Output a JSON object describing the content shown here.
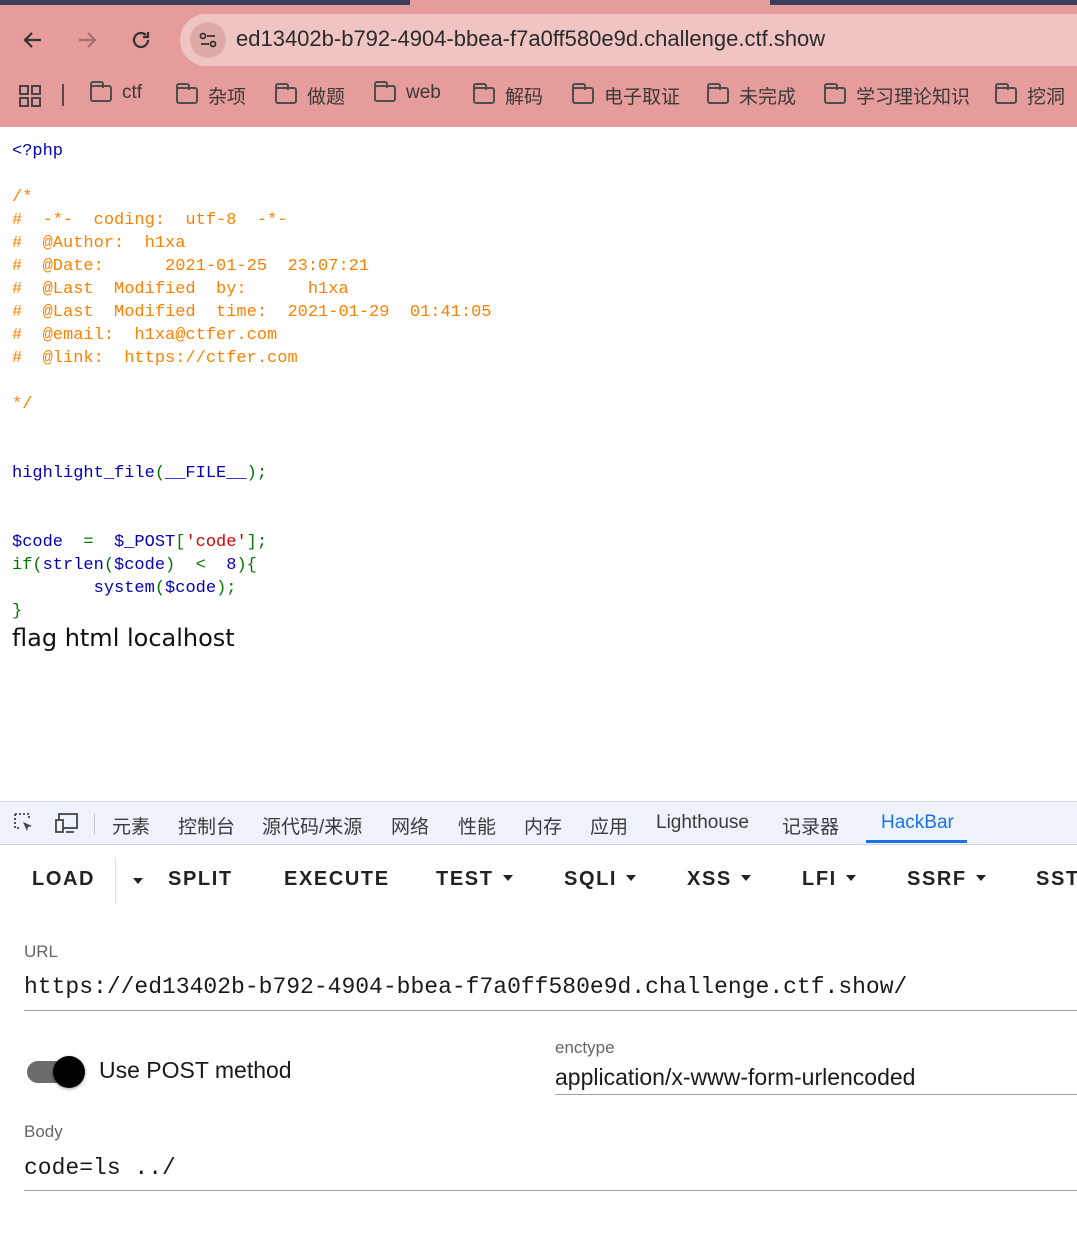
{
  "browser": {
    "url": "ed13402b-b792-4904-bbea-f7a0ff580e9d.challenge.ctf.show",
    "bookmarks": [
      "ctf",
      "杂项",
      "做题",
      "web",
      "解码",
      "电子取证",
      "未完成",
      "学习理论知识",
      "挖洞"
    ]
  },
  "source": {
    "php_open": "<?php",
    "comment_open": "/*",
    "comment_lines": [
      "#  -*-  coding:  utf-8  -*-",
      "#  @Author:  h1xa",
      "#  @Date:      2021-01-25  23:07:21",
      "#  @Last  Modified  by:      h1xa",
      "#  @Last  Modified  time:  2021-01-29  01:41:05",
      "#  @email:  h1xa@ctfer.com",
      "#  @link:  https://ctfer.com"
    ],
    "comment_close": "*/",
    "highlight_fn": "highlight_file",
    "highlight_paren_open": "(",
    "highlight_arg": "__FILE__",
    "highlight_end": ");",
    "code_var": "$code",
    "code_assign": "  =  ",
    "post_var": "$_POST",
    "bracket_open": "[",
    "post_key": "'code'",
    "bracket_close": "];",
    "if_kw": "if",
    "if_paren": "(",
    "strlen_fn": "strlen",
    "strlen_paren": "(",
    "strlen_arg": "$code",
    "if_cmp": ")  <  ",
    "if_num": "8",
    "if_open": "){",
    "system_indent": "        ",
    "system_fn": "system",
    "system_paren": "(",
    "system_arg": "$code",
    "system_end": ");",
    "close_brace": "}"
  },
  "output": "flag html localhost",
  "devtools": {
    "tabs": [
      "元素",
      "控制台",
      "源代码/来源",
      "网络",
      "性能",
      "内存",
      "应用",
      "Lighthouse",
      "记录器",
      "HackBar"
    ],
    "active_tab": "HackBar"
  },
  "hackbar": {
    "buttons": [
      "LOAD",
      "SPLIT",
      "EXECUTE",
      "TEST",
      "SQLI",
      "XSS",
      "LFI",
      "SSRF",
      "SST"
    ],
    "url_label": "URL",
    "url_value": "https://ed13402b-b792-4904-bbea-f7a0ff580e9d.challenge.ctf.show/",
    "post_toggle_label": "Use POST method",
    "post_enabled": true,
    "enctype_label": "enctype",
    "enctype_value": "application/x-www-form-urlencoded",
    "body_label": "Body",
    "body_value": "code=ls ../"
  },
  "colors": {
    "chrome_bg": "#e59c9a",
    "php_keyword": "#0000bb",
    "php_comment": "#ff8000",
    "php_punct": "#007700",
    "php_string": "#dd0000",
    "devtools_active": "#1a73e8"
  }
}
